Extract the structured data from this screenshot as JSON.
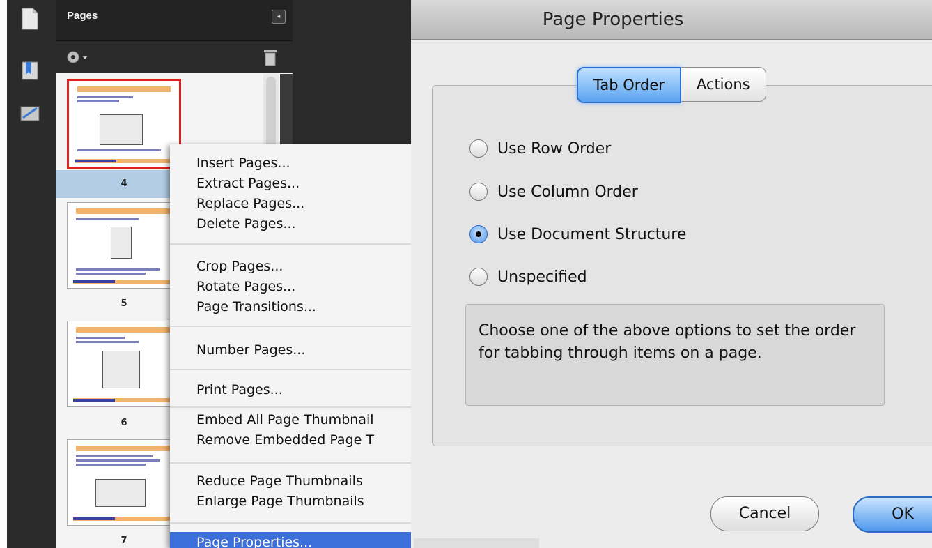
{
  "pages_panel": {
    "title": "Pages",
    "thumbnails": [
      {
        "page": "4",
        "selected": true
      },
      {
        "page": "5",
        "selected": false
      },
      {
        "page": "6",
        "selected": false
      },
      {
        "page": "7",
        "selected": false
      }
    ]
  },
  "context_menu": {
    "groups": [
      [
        "Insert Pages...",
        "Extract Pages...",
        "Replace Pages...",
        "Delete Pages..."
      ],
      [
        "Crop Pages...",
        "Rotate Pages...",
        "Page Transitions..."
      ],
      [
        "Number Pages..."
      ],
      [
        "Print Pages..."
      ],
      [
        "Embed All Page Thumbnail",
        "Remove Embedded Page T"
      ],
      [
        "Reduce Page Thumbnails",
        "Enlarge Page Thumbnails"
      ]
    ],
    "highlighted": "Page Properties..."
  },
  "dialog": {
    "title": "Page Properties",
    "tabs": [
      {
        "label": "Tab Order",
        "active": true
      },
      {
        "label": "Actions",
        "active": false
      }
    ],
    "options": [
      {
        "label": "Use Row Order",
        "checked": false
      },
      {
        "label": "Use Column Order",
        "checked": false
      },
      {
        "label": "Use Document Structure",
        "checked": true
      },
      {
        "label": "Unspecified",
        "checked": false
      }
    ],
    "help_text": "Choose one of the above options to set the order for tabbing through items on a page.",
    "cancel_label": "Cancel",
    "ok_label": "OK"
  },
  "colors": {
    "accent": "#3d6fdb",
    "selection_red": "#e02020",
    "primary_button": "#4f98ec"
  }
}
